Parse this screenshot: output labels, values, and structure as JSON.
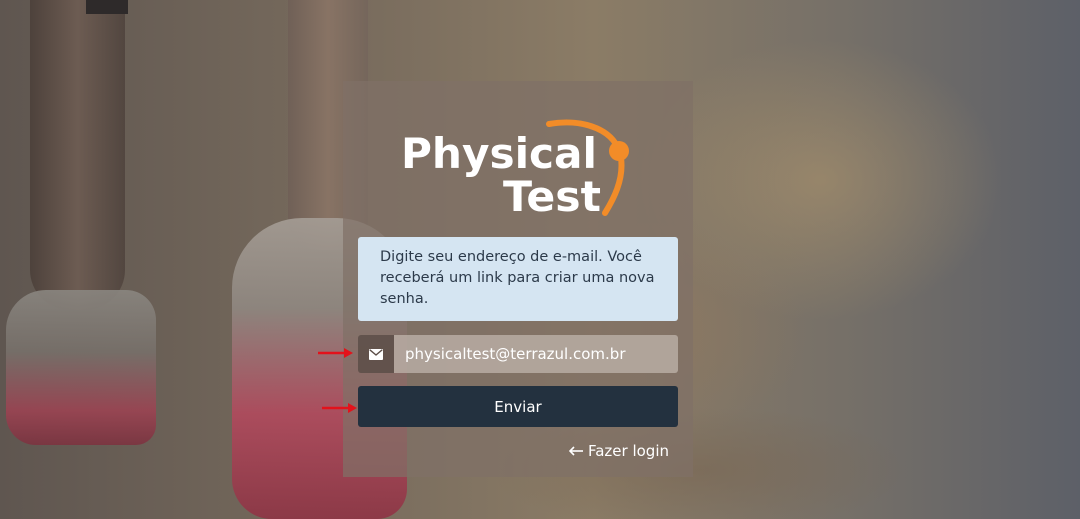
{
  "logo": {
    "line1": "Physical",
    "line2": "Test",
    "accent_color": "#f28c28"
  },
  "info": {
    "message": "Digite seu endereço de e-mail. Você receberá um link para criar uma nova senha."
  },
  "email_field": {
    "icon": "envelope-icon",
    "value": "physicaltest@terrazul.com.br"
  },
  "send_button": {
    "label": "Enviar"
  },
  "login_link": {
    "icon": "arrow-left-icon",
    "label": "Fazer login"
  },
  "markers": {
    "color": "#e3121b"
  },
  "colors": {
    "button_bg": "#23313f",
    "info_bg": "#d5e5f2"
  }
}
